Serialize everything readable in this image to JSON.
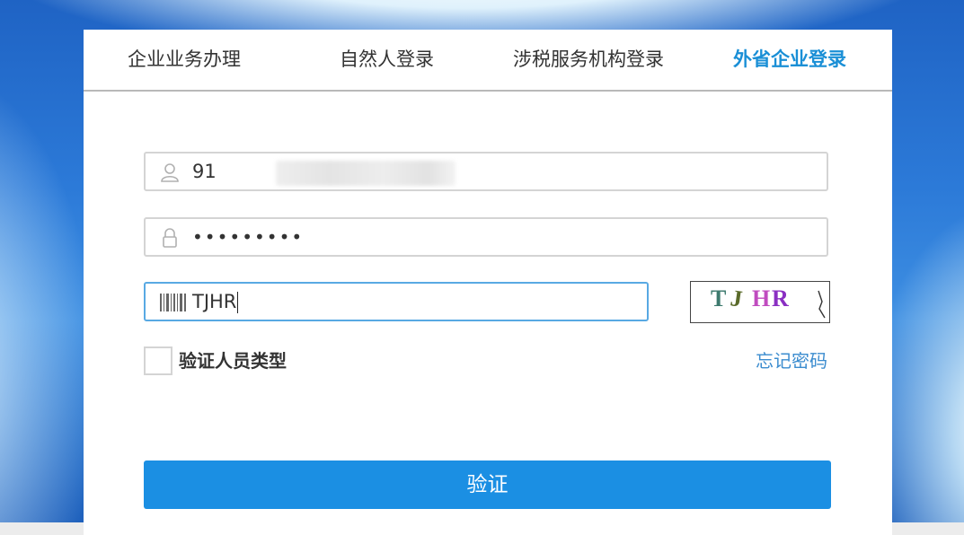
{
  "tabs": [
    {
      "label": "企业业务办理"
    },
    {
      "label": "自然人登录"
    },
    {
      "label": "涉税服务机构登录"
    },
    {
      "label": "外省企业登录",
      "active": true
    }
  ],
  "form": {
    "account": {
      "value": "91",
      "icon": "user-icon"
    },
    "password": {
      "value": "•••••••••",
      "icon": "lock-icon"
    },
    "captcha_input": {
      "value": "TJHR",
      "icon": "barcode-icon"
    },
    "captcha_image": {
      "chars": [
        "T",
        "J",
        "H",
        "R"
      ]
    },
    "checkbox_label": "验证人员类型",
    "forgot_label": "忘记密码",
    "submit_label": "验证"
  },
  "colors": {
    "accent": "#1a8fd6",
    "button": "#1b8fe3",
    "link": "#3b8ccf"
  }
}
